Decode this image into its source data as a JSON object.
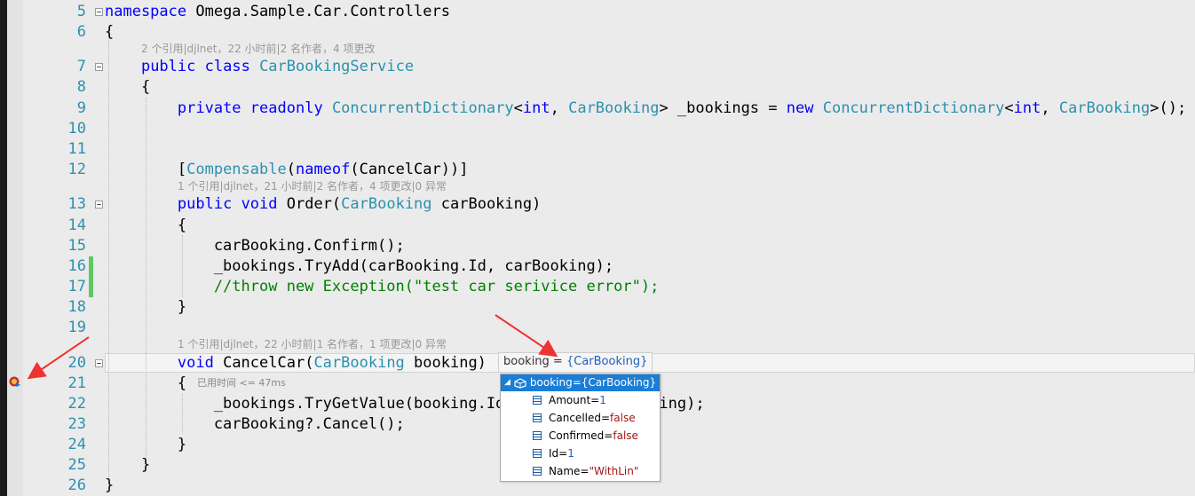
{
  "editor": {
    "lines": [
      {
        "num": "5",
        "text": "namespace Omega.Sample.Car.Controllers"
      },
      {
        "num": "6",
        "text": "{"
      },
      {
        "num": "7",
        "text": "    public class CarBookingService"
      },
      {
        "num": "8",
        "text": "    {"
      },
      {
        "num": "9",
        "text": "        private readonly ConcurrentDictionary<int, CarBooking> _bookings = new ConcurrentDictionary<int, CarBooking>();"
      },
      {
        "num": "10",
        "text": ""
      },
      {
        "num": "11",
        "text": ""
      },
      {
        "num": "12",
        "text": "        [Compensable(nameof(CancelCar))]"
      },
      {
        "num": "13",
        "text": "        public void Order(CarBooking carBooking)"
      },
      {
        "num": "14",
        "text": "        {"
      },
      {
        "num": "15",
        "text": "            carBooking.Confirm();"
      },
      {
        "num": "16",
        "text": "            _bookings.TryAdd(carBooking.Id, carBooking);"
      },
      {
        "num": "17",
        "text": "            //throw new Exception(\"test car serivice error\");"
      },
      {
        "num": "18",
        "text": "        }"
      },
      {
        "num": "19",
        "text": ""
      },
      {
        "num": "20",
        "text": "        void CancelCar(CarBooking booking)"
      },
      {
        "num": "21",
        "text": "        {"
      },
      {
        "num": "22",
        "text": "            _bookings.TryGetValue(booking.Id, out var carBooking);"
      },
      {
        "num": "23",
        "text": "            carBooking?.Cancel();"
      },
      {
        "num": "24",
        "text": "        }"
      },
      {
        "num": "25",
        "text": "    }"
      },
      {
        "num": "26",
        "text": "}"
      }
    ],
    "codelens": {
      "class": "2 个引用|djlnet，22 小时前|2 名作者，4 项更改",
      "order": "1 个引用|djlnet，21 小时前|2 名作者，4 项更改|0 异常",
      "cancel": "1 个引用|djlnet，22 小时前|1 名作者，1 项更改|0 异常"
    },
    "elapsed_hint": "已用时间 <= 47ms"
  },
  "datatip": {
    "summary": "booking = {CarBooking}",
    "summary_name": "booking = ",
    "summary_value": "{CarBooking}",
    "header": "booking={CarBooking}",
    "fields": [
      {
        "name": "Amount=",
        "value": "1",
        "kind": "number"
      },
      {
        "name": "Cancelled=",
        "value": "false",
        "kind": "bool"
      },
      {
        "name": "Confirmed=",
        "value": "false",
        "kind": "bool"
      },
      {
        "name": "Id=",
        "value": "1",
        "kind": "number"
      },
      {
        "name": "Name=",
        "value": "\"WithLin\"",
        "kind": "string"
      }
    ]
  },
  "colors": {
    "keyword": "#0000ff",
    "type": "#2b91af",
    "comment": "#008000",
    "line_number": "#2b91af",
    "datatip_header": "#1a7dd6",
    "arrow": "#ee3333",
    "change_bar": "#5fc763"
  },
  "icons": [
    "breakpoint-icon",
    "fold-toggle-icon",
    "expand-triangle-icon",
    "object-icon",
    "field-icon",
    "red-arrow-icon"
  ]
}
